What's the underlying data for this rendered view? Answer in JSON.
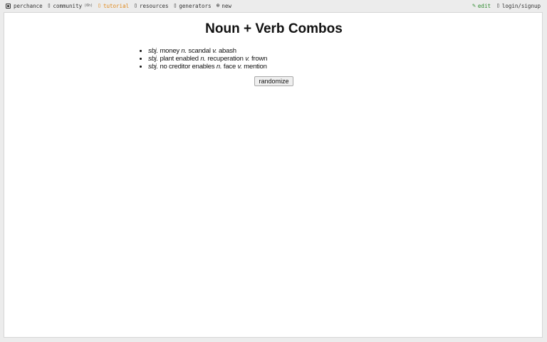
{
  "nav": {
    "home_label": "perchance",
    "community_label": "community",
    "community_badge": "(6h)",
    "tutorial_label": "tutorial",
    "resources_label": "resources",
    "generators_label": "generators",
    "new_label": "new",
    "edit_label": "edit",
    "login_label": "login/signup",
    "icons": {
      "home": "dice-icon",
      "community": "chat-icon",
      "tutorial": "book-icon",
      "resources": "book-icon",
      "generators": "list-icon",
      "new": "plus-circle-icon",
      "edit": "pencil-icon",
      "login": "user-icon"
    }
  },
  "main": {
    "title": "Noun + Verb Combos",
    "combos": [
      {
        "sbj_tag": "sbj.",
        "subject": "money",
        "n_tag": "n.",
        "noun": "scandal",
        "v_tag": "v.",
        "verb": "abash"
      },
      {
        "sbj_tag": "sbj.",
        "subject": "plant enabled",
        "n_tag": "n.",
        "noun": "recuperation",
        "v_tag": "v.",
        "verb": "frown"
      },
      {
        "sbj_tag": "sbj.",
        "subject": "no creditor enables",
        "n_tag": "n.",
        "noun": "face",
        "v_tag": "v.",
        "verb": "mention"
      }
    ],
    "randomize_label": "randomize"
  },
  "colors": {
    "tutorial": "#e08a1e",
    "edit": "#2e8b2e",
    "background": "#ececec",
    "panel": "#ffffff"
  }
}
